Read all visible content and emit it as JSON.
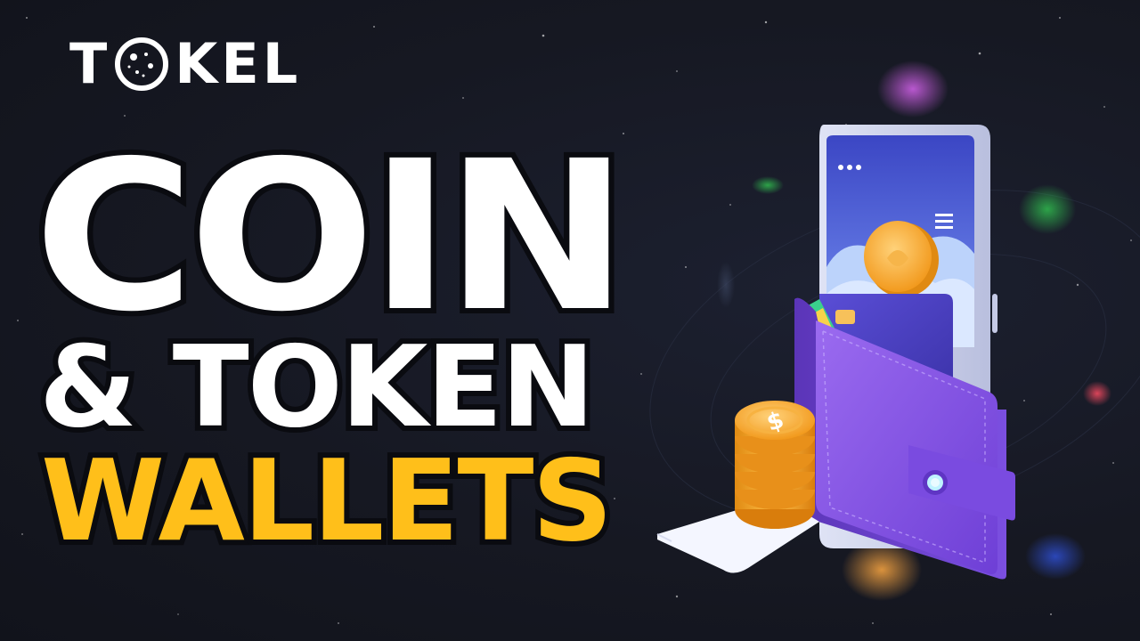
{
  "logo": {
    "letters_before": "T",
    "letters_after": "KEL",
    "icon": "planet-icon"
  },
  "headline": {
    "line1": "COIN",
    "line2": "& TOKEN",
    "line3": "WALLETS"
  },
  "colors": {
    "background": "#161822",
    "title_white": "#ffffff",
    "title_yellow": "#ffbf1a",
    "wallet_purple": "#8b5cf6",
    "coin_gold": "#f7a928"
  },
  "illustration": {
    "phone_icon": "smartphone-icon",
    "wallet_icon": "wallet-icon",
    "coin_icon": "coin-stack-icon",
    "receipt_icon": "receipt-icon",
    "dollar_sign": "$"
  }
}
